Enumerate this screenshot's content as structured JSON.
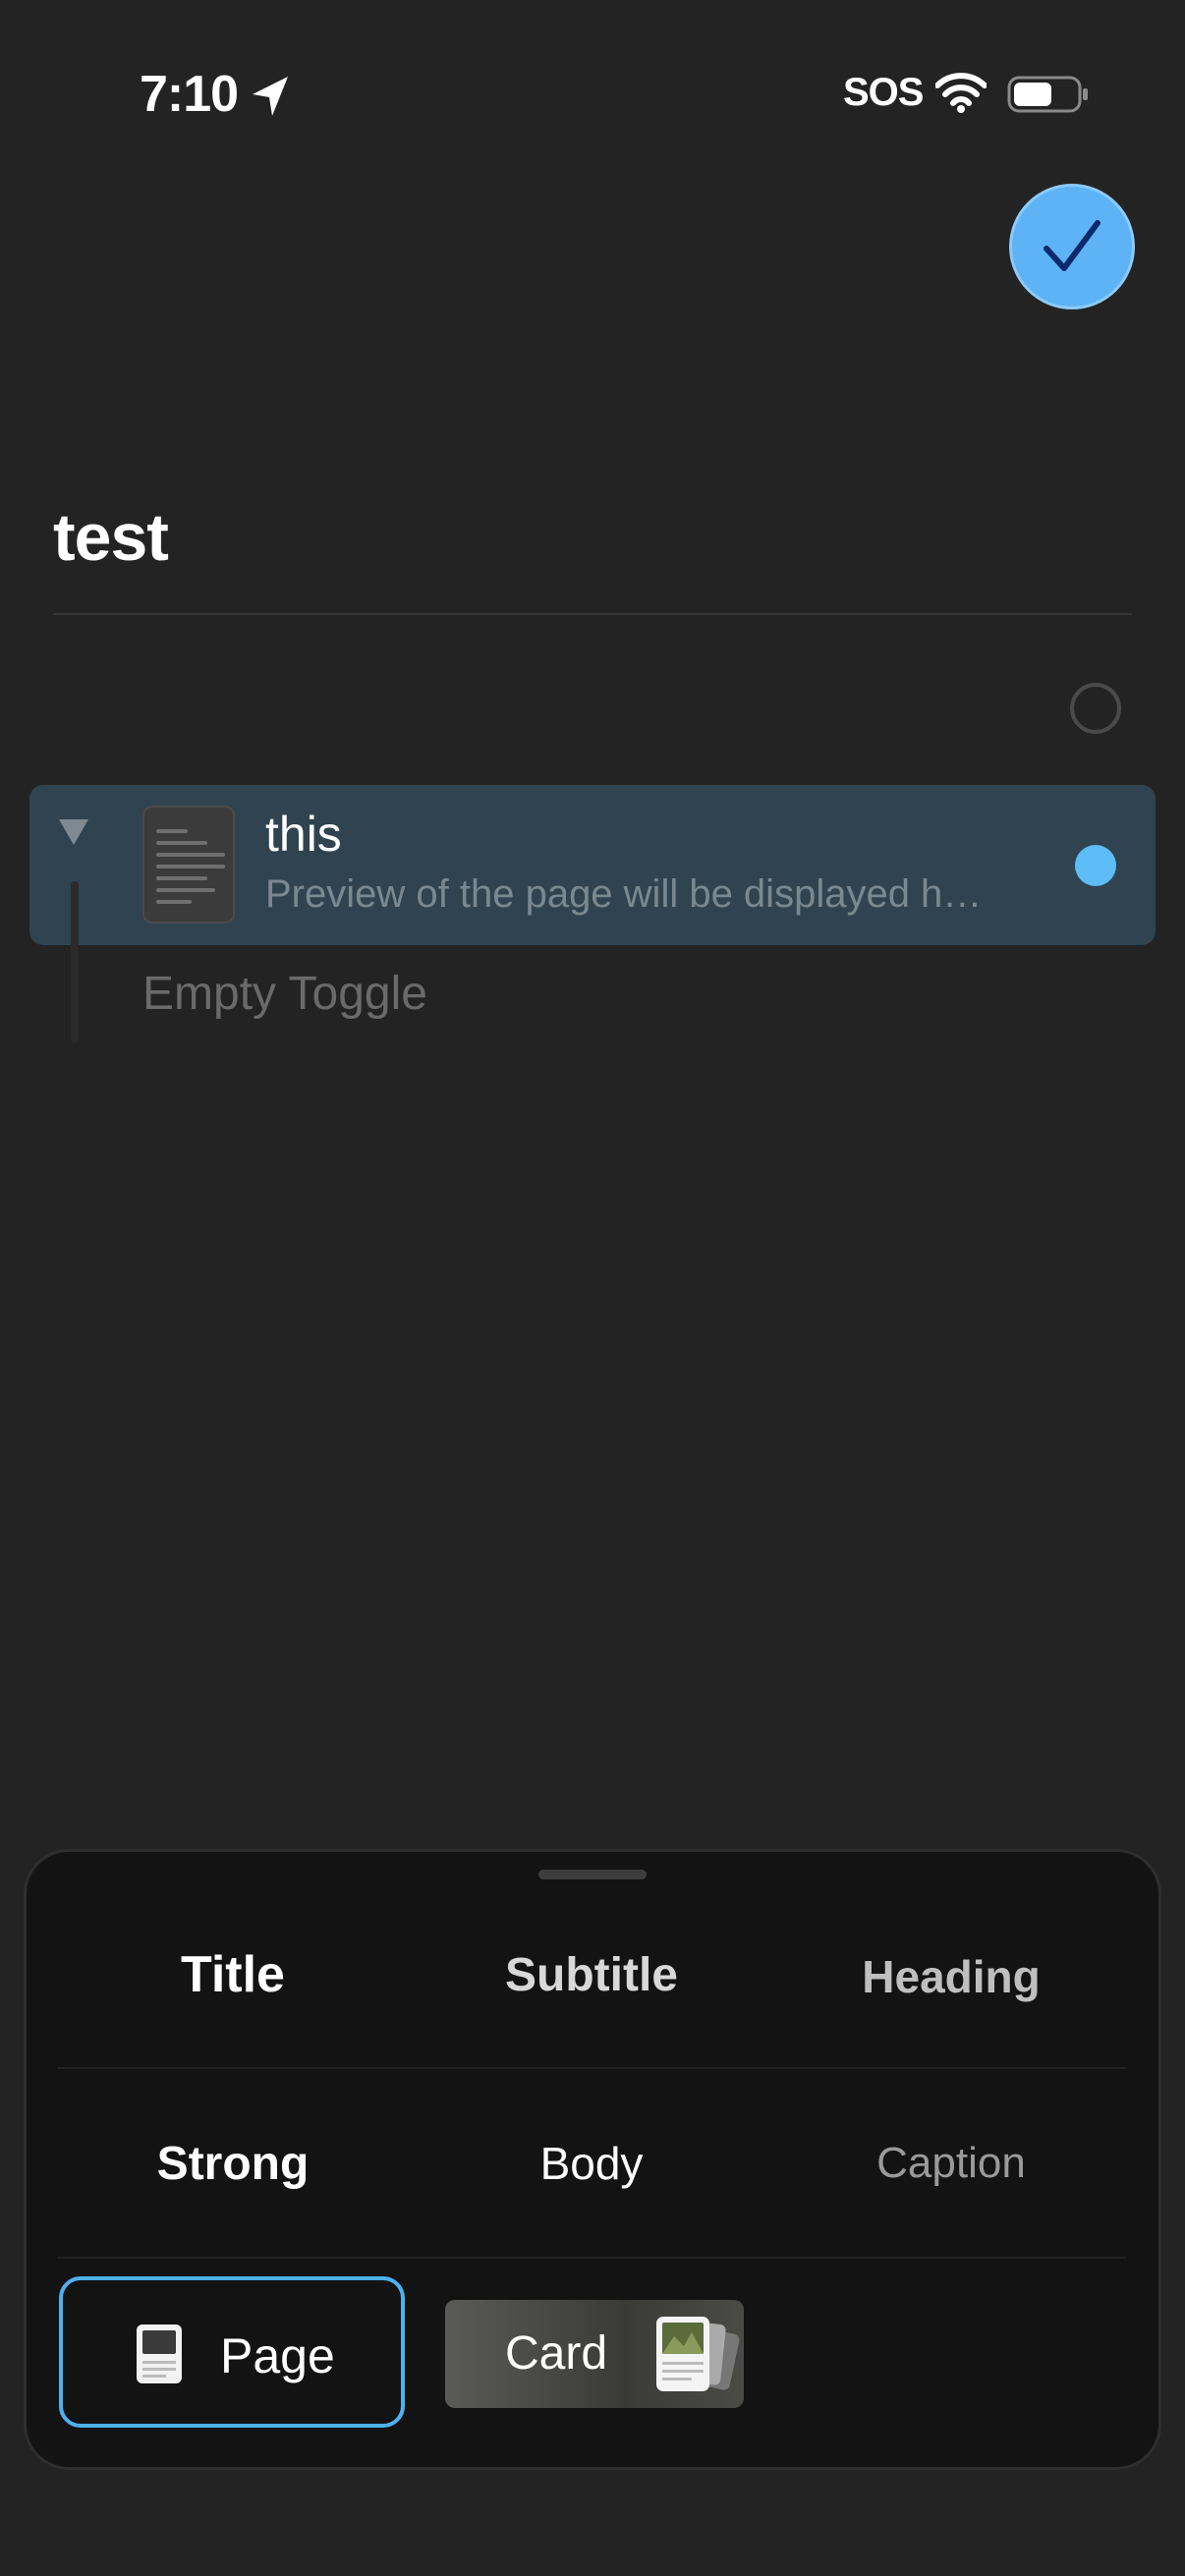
{
  "status_bar": {
    "time": "7:10",
    "sos": "SOS"
  },
  "page": {
    "title": "test"
  },
  "toggle_row": {
    "title": "this",
    "preview": "Preview of the page will be displayed h…",
    "empty_label": "Empty Toggle"
  },
  "style_options": {
    "row1": [
      "Title",
      "Subtitle",
      "Heading"
    ],
    "row2": [
      "Strong",
      "Body",
      "Caption"
    ]
  },
  "block_types": {
    "page_label": "Page",
    "card_label": "Card"
  },
  "colors": {
    "accent": "#5db3f5",
    "selected_row": "#2f4450",
    "background": "#232323"
  }
}
